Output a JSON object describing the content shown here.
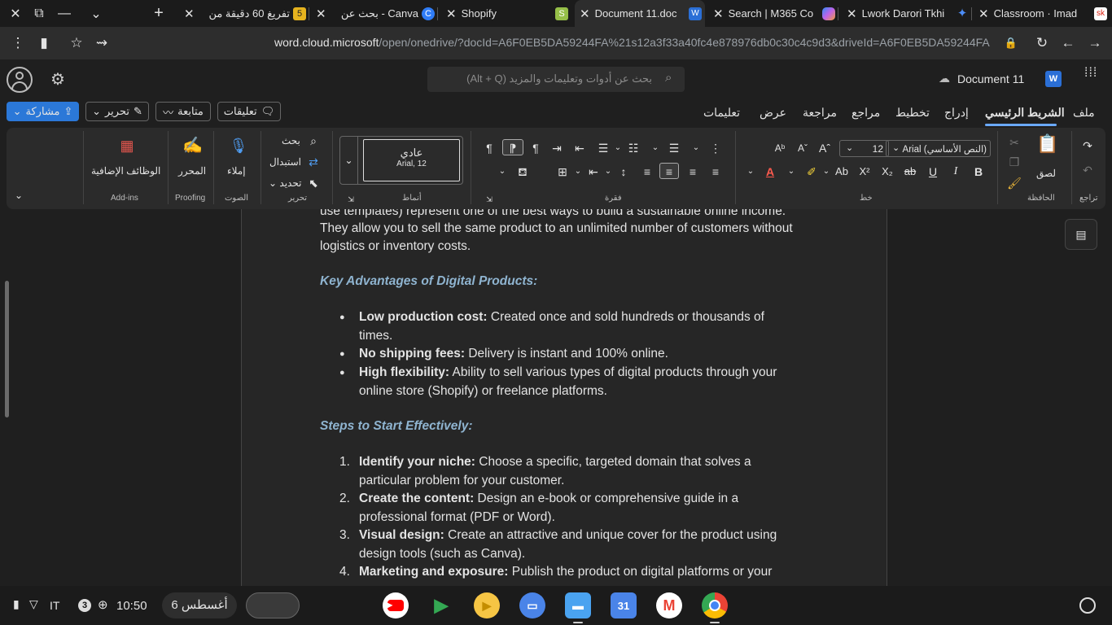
{
  "tabs": [
    {
      "title": "تفريغ 60 دقيقة من",
      "badge": "5",
      "color": "#e6b31e"
    },
    {
      "title": "Canva - بحث عن",
      "badge": "C",
      "color": "#2f7cf6"
    },
    {
      "title": "Shopify",
      "badge": "S",
      "color": "#96bf48"
    },
    {
      "title": "Document 11.doc",
      "badge": "W",
      "color": "#2b6fd6"
    },
    {
      "title": "Search | M365 Co",
      "badge": "",
      "color": "#c062e8"
    },
    {
      "title": "Lwork Darori Tkhi",
      "badge": "",
      "color": "#4c8df6"
    },
    {
      "title": "Classroom · Imad",
      "badge": "sk",
      "color": "#f3f3f3"
    }
  ],
  "url": {
    "host": "word.cloud.microsoft",
    "path": "/open/onedrive/?docId=A6F0EB5DA59244FA%21s12a3f33a40fc4e878976db0c30c4c9d3&driveId=A6F0EB5DA59244FA"
  },
  "word": {
    "search_placeholder": "بحث عن أدوات وتعليمات والمزيد (Alt + Q)",
    "doc_title": "Document 11"
  },
  "menu": {
    "tabs": [
      "ملف",
      "الشريط الرئيسي",
      "إدراج",
      "تخطيط",
      "مراجع",
      "مراجعة",
      "عرض",
      "تعليمات"
    ],
    "comments": "تعليقات",
    "followup": "متابعة",
    "editing": "تحرير",
    "share": "مشاركة"
  },
  "ribbon": {
    "undo_label": "تراجع",
    "paste_label": "لصق",
    "clipboard_label": "الحافظة",
    "font_name": "Arial (النص الأساسي)",
    "font_size": "12",
    "font_label": "خط",
    "paragraph_label": "فقرة",
    "style_name": "عادي",
    "style_font": "Arial, 12",
    "styles_label": "أنماط",
    "find": "بحث",
    "replace": "استبدال",
    "select": "تحديد",
    "editing_label": "تحرير",
    "dictate": "إملاء",
    "voice_label": "الصوت",
    "editor": "المحرر",
    "proofing_label": "Proofing",
    "addins": "الوظائف الإضافية",
    "addins_label": "Add-ins"
  },
  "document": {
    "intro_line1": "use templates) represent one of the best ways to build a sustainable online income.",
    "intro_line2": "They allow you to sell the same product to an unlimited number of customers without",
    "intro_line3": "logistics or inventory costs.",
    "heading1": "Key Advantages of Digital Products:",
    "bullets": [
      {
        "bold": "Low production cost:",
        "text": " Created once and sold hundreds or thousands of",
        "cont": "times."
      },
      {
        "bold": "No shipping fees:",
        "text": " Delivery is instant and 100% online.",
        "cont": ""
      },
      {
        "bold": "High flexibility:",
        "text": " Ability to sell various types of digital products through your",
        "cont": "online store (Shopify) or freelance platforms."
      }
    ],
    "heading2": "Steps to Start Effectively:",
    "steps": [
      {
        "num": "1.",
        "bold": "Identify your niche:",
        "text": " Choose a specific, targeted domain that solves a",
        "cont": "particular problem for your customer."
      },
      {
        "num": "2.",
        "bold": "Create the content:",
        "text": " Design an e-book or comprehensive guide in a",
        "cont": "professional format (PDF or Word)."
      },
      {
        "num": "3.",
        "bold": "Visual design:",
        "text": " Create an attractive and unique cover for the product using",
        "cont": "design tools (such as Canva)."
      },
      {
        "num": "4.",
        "bold": "Marketing and exposure:",
        "text": " Publish the product on digital platforms or your",
        "cont": ""
      }
    ]
  },
  "shelf": {
    "date": "6 أغسطس",
    "time": "10:50",
    "notif_count": "3",
    "locale": "IT"
  }
}
